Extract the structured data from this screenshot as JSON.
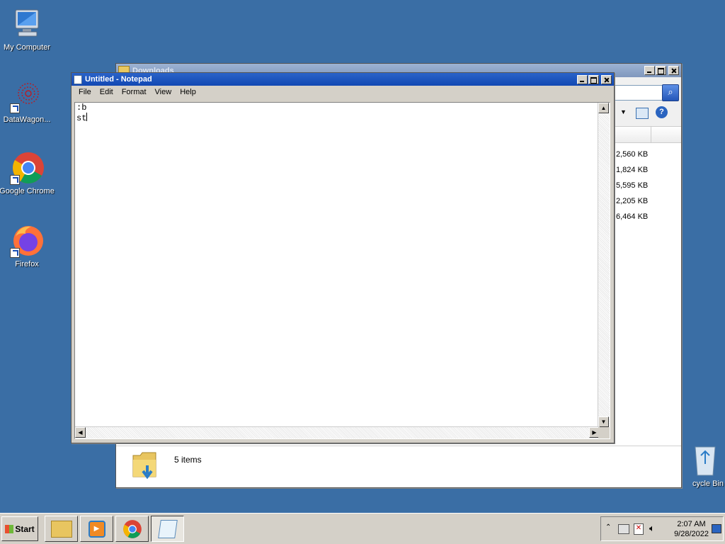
{
  "desktop": {
    "icons": [
      {
        "label": "My Computer",
        "icon": "computer-icon"
      },
      {
        "label": "DataWagon...",
        "icon": "datawagon-icon"
      },
      {
        "label": "Google Chrome",
        "icon": "chrome-icon"
      },
      {
        "label": "Firefox",
        "icon": "firefox-icon"
      }
    ],
    "recycle_bin_label": "cycle Bin"
  },
  "explorer": {
    "title": "Downloads",
    "sizes": [
      "2,560 KB",
      "1,824 KB",
      "5,595 KB",
      "2,205 KB",
      "6,464 KB"
    ],
    "status_text": "5 items"
  },
  "notepad": {
    "title": "Untitled - Notepad",
    "menu": [
      "File",
      "Edit",
      "Format",
      "View",
      "Help"
    ],
    "content_line1": ":b",
    "content_line2": "st"
  },
  "taskbar": {
    "start_label": "Start",
    "clock_time": "2:07 AM",
    "clock_date": "9/28/2022"
  },
  "colors": {
    "desktop_bg": "#3a6ea5",
    "titlebar_active": "#1c54bf",
    "taskbar_bg": "#d4d0c8"
  }
}
